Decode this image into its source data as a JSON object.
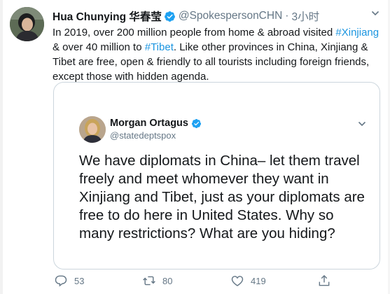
{
  "tweet": {
    "author_name": "Hua Chunying 华春莹",
    "handle": "@SpokespersonCHN",
    "separator": "·",
    "time": "3小时",
    "text_parts": {
      "p1": "In 2019, over 200 million people from home & abroad visited ",
      "tag1": "#Xinjiang",
      "p2": " & over 40 million to ",
      "tag2": "#Tibet",
      "p3": ". Like other provinces in China, Xinjiang & Tibet are free, open & friendly to all tourists including foreign friends, except those with hidden agenda."
    },
    "icons": {
      "verified": "verified-badge-icon",
      "more": "chevron-down-icon"
    }
  },
  "quoted": {
    "author_name": "Morgan Ortagus",
    "handle": "@statedeptspox",
    "text": "We have diplomats in China– let them travel freely and meet whomever they want in Xinjiang and Tibet, just as your diplomats are free to do here in United States. Why so many restrictions? What are you hiding?"
  },
  "actions": {
    "reply_count": "53",
    "retweet_count": "80",
    "like_count": "419",
    "icons": [
      "reply-icon",
      "retweet-icon",
      "like-icon",
      "share-icon"
    ]
  },
  "colors": {
    "link": "#1b95e0",
    "muted": "#657786",
    "border": "#ccd6dd",
    "verified": "#1da1f2"
  }
}
